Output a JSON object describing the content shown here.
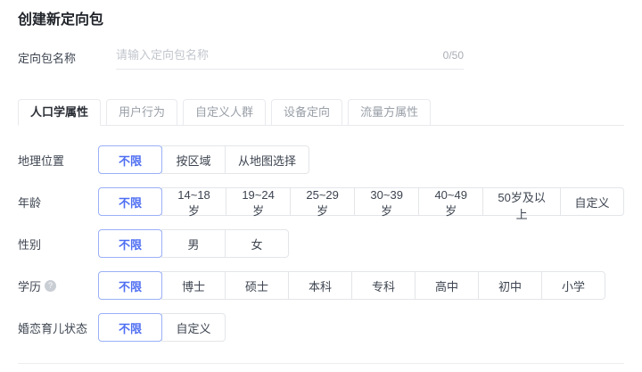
{
  "page": {
    "title": "创建新定向包"
  },
  "name_field": {
    "label": "定向包名称",
    "placeholder": "请输入定向包名称",
    "value": "",
    "counter": "0/50"
  },
  "tabs": [
    {
      "name": "tab-demographics",
      "label": "人口学属性",
      "active": true
    },
    {
      "name": "tab-user-behavior",
      "label": "用户行为",
      "active": false
    },
    {
      "name": "tab-custom-audience",
      "label": "自定义人群",
      "active": false
    },
    {
      "name": "tab-device-targeting",
      "label": "设备定向",
      "active": false
    },
    {
      "name": "tab-traffic-attributes",
      "label": "流量方属性",
      "active": false
    }
  ],
  "rows": [
    {
      "name": "geo-location",
      "label": "地理位置",
      "has_info": false,
      "selected": 0,
      "options": [
        "不限",
        "按区域",
        "从地图选择"
      ]
    },
    {
      "name": "age",
      "label": "年龄",
      "has_info": false,
      "selected": 0,
      "options": [
        "不限",
        "14~18岁",
        "19~24岁",
        "25~29岁",
        "30~39岁",
        "40~49岁",
        "50岁及以上",
        "自定义"
      ]
    },
    {
      "name": "gender",
      "label": "性别",
      "has_info": false,
      "selected": 0,
      "options": [
        "不限",
        "男",
        "女"
      ]
    },
    {
      "name": "education",
      "label": "学历",
      "has_info": true,
      "selected": 0,
      "options": [
        "不限",
        "博士",
        "硕士",
        "本科",
        "专科",
        "高中",
        "初中",
        "小学"
      ]
    },
    {
      "name": "marital-parental-status",
      "label": "婚恋育儿状态",
      "has_info": false,
      "selected": 0,
      "options": [
        "不限",
        "自定义"
      ]
    }
  ],
  "icons": {
    "info": "question-circle-icon",
    "info_glyph": "?"
  },
  "colors": {
    "accent": "#4e6ef2",
    "accent_border": "#9ab0f7",
    "border": "#e3e5e9",
    "tab_inactive_text": "#9aa0a8",
    "text": "#3d4450",
    "placeholder": "#c2c6cd"
  }
}
